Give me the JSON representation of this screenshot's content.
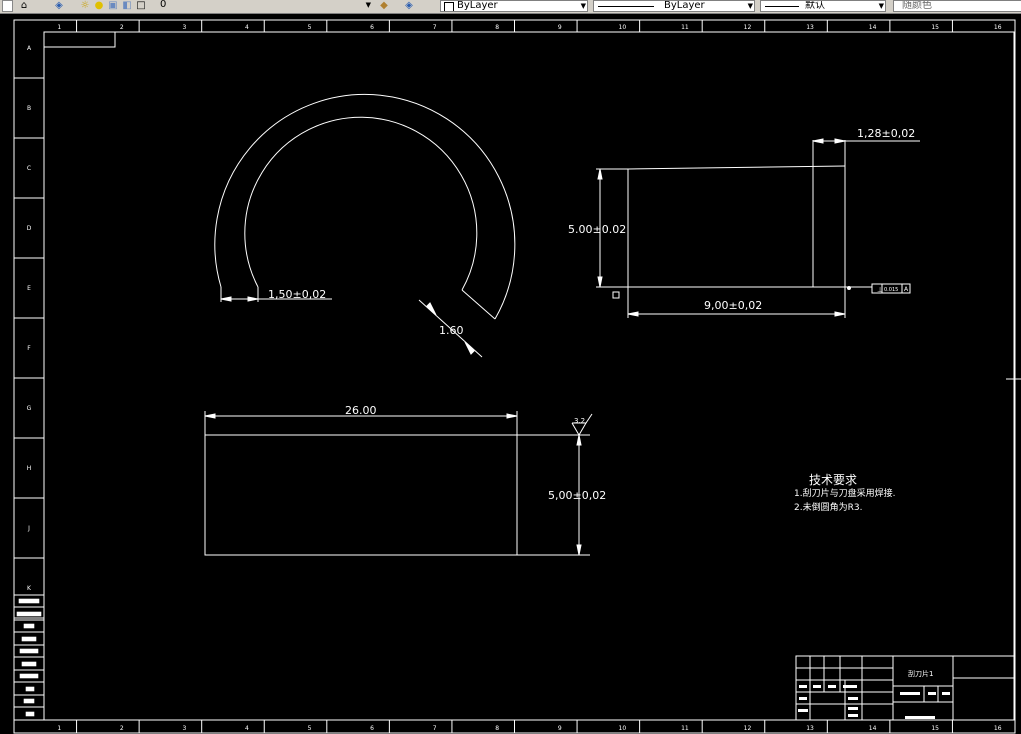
{
  "toolbar": {
    "layer_value": "0",
    "color_value": "ByLayer",
    "linetype_value": "ByLayer",
    "lineweight_value": "默认",
    "plotstyle_value": "随颜色"
  },
  "ruler": {
    "columns": [
      "1",
      "2",
      "3",
      "4",
      "5",
      "6",
      "7",
      "8",
      "9",
      "10",
      "11",
      "12",
      "13",
      "14",
      "15",
      "16"
    ],
    "rows": [
      "A",
      "B",
      "C",
      "D",
      "E",
      "F",
      "G",
      "H",
      "J",
      "K"
    ]
  },
  "dimensions": {
    "arc_end_width": "1,50±0,02",
    "arc_slot_width": "1.60",
    "blade_thickness": "1,28±0,02",
    "side_height": "5.00±0.02",
    "side_width": "9,00±0,02",
    "front_width": "26.00",
    "front_height": "5,00±0,02",
    "roughness": "3.2",
    "tolerance_box": "0.015"
  },
  "notes": {
    "title": "技术要求",
    "line1": "1.刮刀片与刀盘采用焊接.",
    "line2": "2.未倒圆角为R3."
  },
  "title_block": {
    "part_name": "刮刀片1"
  }
}
